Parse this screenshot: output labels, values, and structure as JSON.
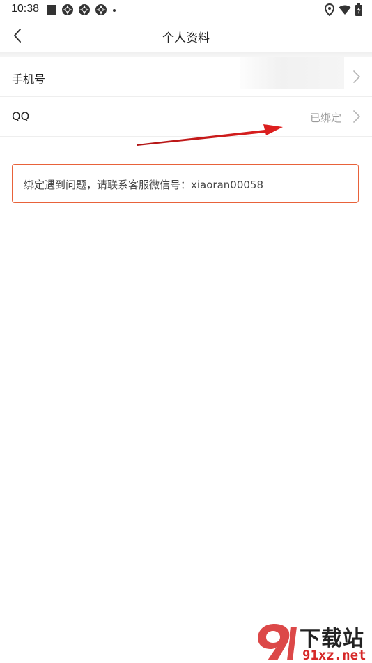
{
  "status_bar": {
    "time": "10:38"
  },
  "header": {
    "title": "个人资料"
  },
  "rows": [
    {
      "label": "手机号",
      "value": ""
    },
    {
      "label": "QQ",
      "value": "已绑定"
    }
  ],
  "notice": {
    "text": "绑定遇到问题，请联系客服微信号：xiaoran00058"
  },
  "watermark": {
    "cn": "下载站",
    "en": "91xz.net"
  },
  "colors": {
    "notice_border": "#e8623a",
    "annotation_arrow": "#d81e1e",
    "watermark_red": "#d62828"
  }
}
